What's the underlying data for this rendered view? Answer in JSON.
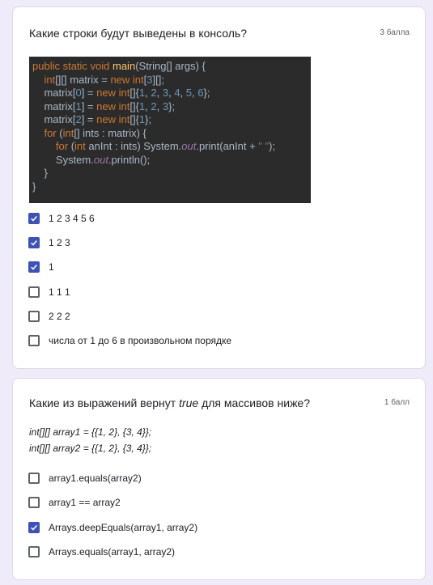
{
  "q1": {
    "title": "Какие строки будут выведены в консоль?",
    "points": "3 балла",
    "options": [
      {
        "label": "1 2 3 4 5 6",
        "checked": true
      },
      {
        "label": "1 2 3",
        "checked": true
      },
      {
        "label": "1",
        "checked": true
      },
      {
        "label": "1 1 1",
        "checked": false
      },
      {
        "label": "2 2 2",
        "checked": false
      },
      {
        "label": "числа от 1 до 6 в произвольном порядке",
        "checked": false
      }
    ]
  },
  "q2": {
    "title_pre": "Какие из выражений вернут ",
    "title_em": "true",
    "title_post": " для массивов ниже?",
    "points": "1 балл",
    "code": [
      "int[][] array1 = {{1, 2}, {3, 4}};",
      "int[][] array2 = {{1, 2}, {3, 4}};"
    ],
    "options": [
      {
        "label": "array1.equals(array2)",
        "checked": false
      },
      {
        "label": "array1 == array2",
        "checked": false
      },
      {
        "label": "Arrays.deepEquals(array1, array2)",
        "checked": true
      },
      {
        "label": "Arrays.equals(array1, array2)",
        "checked": false
      }
    ]
  },
  "colors": {
    "background": "#f0ebf8",
    "checkbox_checked": "#3f51b5",
    "code_background": "#2b2b2b"
  }
}
